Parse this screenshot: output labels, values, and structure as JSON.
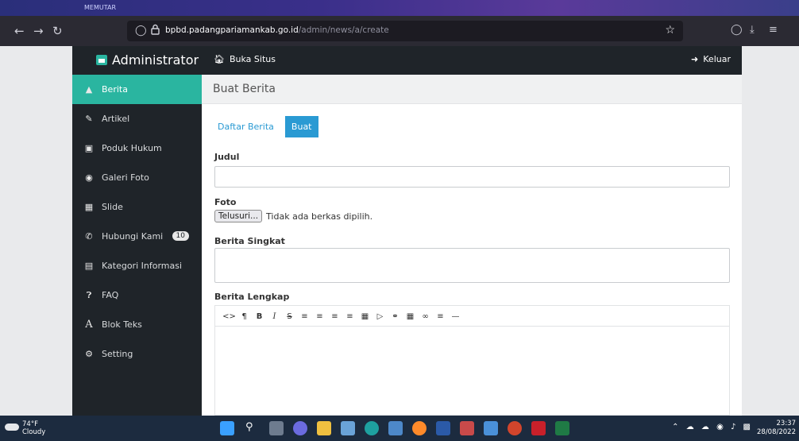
{
  "browser": {
    "tabs": [
      "MEMUTAR"
    ],
    "url_domain": "bpbd.padangpariamankab.go.id",
    "url_path": "/admin/news/a/create"
  },
  "header": {
    "brand": "Administrator",
    "visit_site": "Buka Situs",
    "logout": "Keluar"
  },
  "sidebar": {
    "items": [
      {
        "label": "Berita",
        "icon": "megaphone-icon",
        "active": true
      },
      {
        "label": "Artikel",
        "icon": "pencil-icon"
      },
      {
        "label": "Poduk Hukum",
        "icon": "save-icon"
      },
      {
        "label": "Galeri Foto",
        "icon": "camera-icon"
      },
      {
        "label": "Slide",
        "icon": "image-icon"
      },
      {
        "label": "Hubungi Kami",
        "icon": "phone-icon",
        "badge": "10"
      },
      {
        "label": "Kategori Informasi",
        "icon": "list-icon"
      },
      {
        "label": "FAQ",
        "icon": "question-icon"
      },
      {
        "label": "Blok Teks",
        "icon": "font-icon"
      },
      {
        "label": "Setting",
        "icon": "gear-icon"
      }
    ]
  },
  "main": {
    "page_title": "Buat Berita",
    "tabs": [
      "Daftar Berita",
      "Buat"
    ],
    "fields": {
      "judul_label": "Judul",
      "judul_value": "",
      "foto_label": "Foto",
      "file_button": "Telusuri...",
      "file_status": "Tidak ada berkas dipilih.",
      "singkat_label": "Berita Singkat",
      "singkat_value": "",
      "lengkap_label": "Berita Lengkap"
    }
  },
  "taskbar": {
    "temperature": "74°F",
    "weather": "Cloudy",
    "time": "23:37",
    "date": "28/08/2022"
  },
  "colors": {
    "accent": "#2ab5a0",
    "sidebar_bg": "#1f2429",
    "button_blue": "#2a9ad3"
  }
}
